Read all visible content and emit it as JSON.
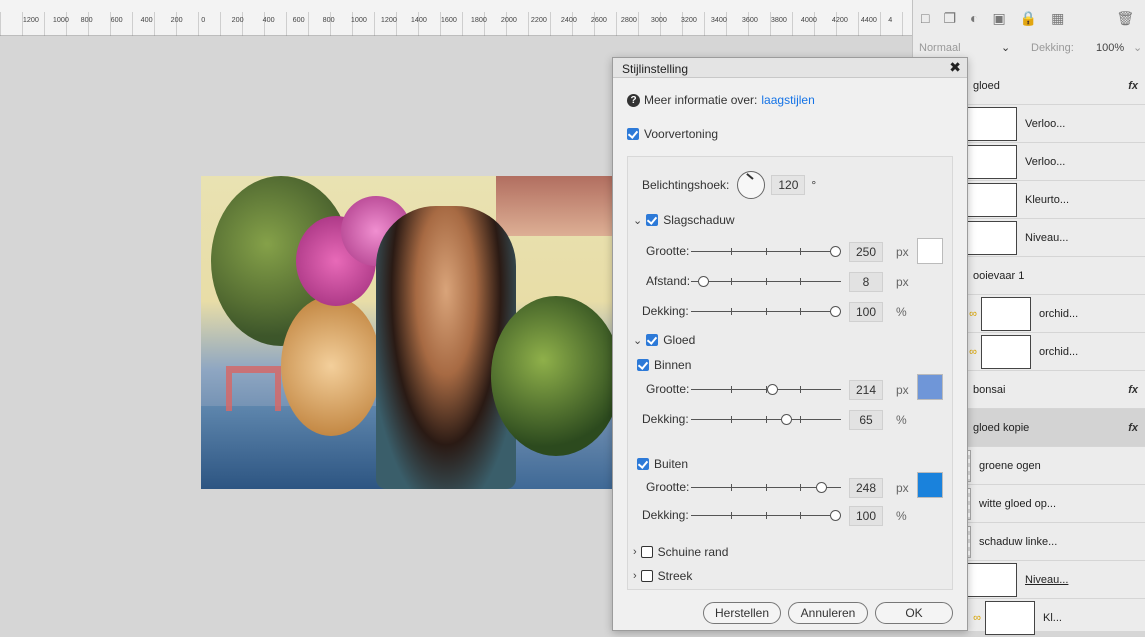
{
  "ruler": {
    "labels": [
      "1200",
      "1000",
      "800",
      "600",
      "400",
      "200",
      "0",
      "200",
      "400",
      "600",
      "800",
      "1000",
      "1200",
      "1400",
      "1600",
      "1800",
      "2000",
      "2200",
      "2400",
      "2600",
      "2800",
      "3000",
      "3200",
      "3400",
      "3600",
      "3800",
      "4000",
      "4200",
      "4400",
      "4"
    ]
  },
  "panel": {
    "toolbar_icons": [
      "new-layer-icon",
      "duplicate-icon",
      "fill-icon",
      "mask-icon",
      "lock-icon",
      "merge-icon",
      "trash-icon"
    ],
    "blend_mode": "Normaal",
    "opacity_label": "Dekking:",
    "opacity_value": "100%",
    "layers": [
      {
        "name": "gloed",
        "fx": "fx"
      },
      {
        "name": "Verloo..."
      },
      {
        "name": "Verloo..."
      },
      {
        "name": "Kleurto..."
      },
      {
        "name": "Niveau..."
      },
      {
        "name": "ooievaar 1"
      },
      {
        "name": "orchid..."
      },
      {
        "name": "orchid..."
      },
      {
        "name": "bonsai",
        "fx": "fx"
      },
      {
        "name": "gloed kopie",
        "fx": "fx"
      },
      {
        "name": "groene ogen"
      },
      {
        "name": "witte gloed op..."
      },
      {
        "name": "schaduw linke..."
      },
      {
        "name": "Niveau..."
      },
      {
        "name": "Kl..."
      }
    ]
  },
  "dialog": {
    "title": "Stijlinstelling",
    "info_text": "Meer informatie over:",
    "info_link": "laagstijlen",
    "preview_label": "Voorvertoning",
    "angle_label": "Belichtingshoek:",
    "angle_value": "120",
    "angle_unit": "°",
    "drop_shadow": {
      "label": "Slagschaduw",
      "size_label": "Grootte:",
      "size_value": "250",
      "size_unit": "px",
      "size_level": 1.0,
      "distance_label": "Afstand:",
      "distance_value": "8",
      "distance_unit": "px",
      "distance_level": 0.05,
      "opacity_label": "Dekking:",
      "opacity_value": "100",
      "opacity_unit": "%",
      "opacity_level": 1.0,
      "color": "#ffffff"
    },
    "glow": {
      "label": "Gloed",
      "inner": {
        "label": "Binnen",
        "size_label": "Grootte:",
        "size_value": "214",
        "size_unit": "px",
        "size_level": 0.55,
        "opacity_label": "Dekking:",
        "opacity_value": "65",
        "opacity_unit": "%",
        "opacity_level": 0.65,
        "color": "#6f96d8"
      },
      "outer": {
        "label": "Buiten",
        "size_label": "Grootte:",
        "size_value": "248",
        "size_unit": "px",
        "size_level": 0.9,
        "opacity_label": "Dekking:",
        "opacity_value": "100",
        "opacity_unit": "%",
        "opacity_level": 1.0,
        "color": "#1a82dc"
      }
    },
    "bevel_label": "Schuine rand",
    "stroke_label": "Streek",
    "buttons": {
      "reset": "Herstellen",
      "cancel": "Annuleren",
      "ok": "OK"
    }
  }
}
